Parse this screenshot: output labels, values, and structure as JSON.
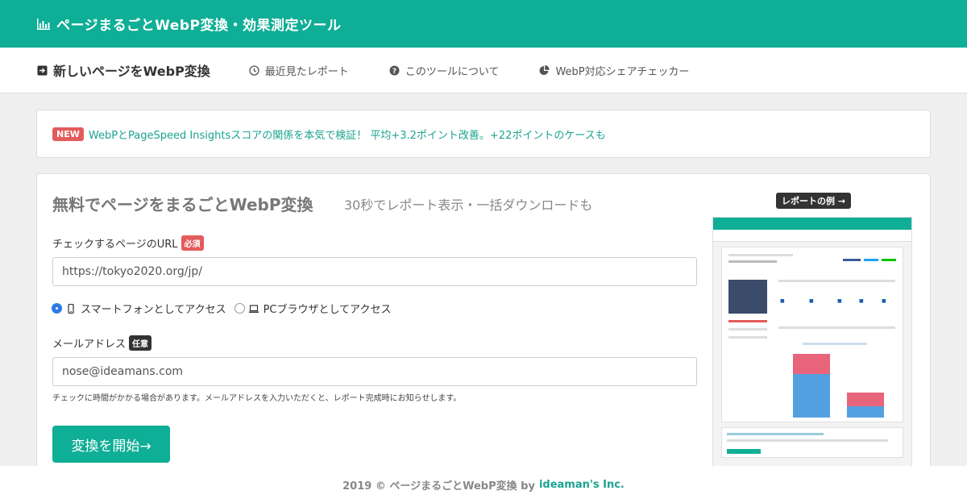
{
  "header": {
    "title": "ページまるごとWebP変換・効果測定ツール",
    "logo_icon": "bar-chart-icon"
  },
  "nav": {
    "items": [
      {
        "label": "新しいページをWebP変換",
        "icon": "sign-in-icon"
      },
      {
        "label": "最近見たレポート",
        "icon": "clock-icon"
      },
      {
        "label": "このツールについて",
        "icon": "question-circle-icon"
      },
      {
        "label": "WebP対応シェアチェッカー",
        "icon": "pie-chart-icon"
      }
    ]
  },
  "notice": {
    "badge": "NEW",
    "text": "WebPとPageSpeed Insightsスコアの関係を本気で検証！ 平均+3.2ポイント改善。+22ポイントのケースも"
  },
  "form": {
    "title": "無料でページをまるごとWebP変換",
    "subtitle": "30秒でレポート表示・一括ダウンロードも",
    "url_label": "チェックするページのURL",
    "url_required": "必須",
    "url_value": "https://tokyo2020.org/jp/",
    "device_options": [
      {
        "label": "スマートフォンとしてアクセス",
        "checked": true,
        "icon": "mobile-icon"
      },
      {
        "label": "PCブラウザとしてアクセス",
        "checked": false,
        "icon": "laptop-icon"
      }
    ],
    "email_label": "メールアドレス",
    "email_optional": "任意",
    "email_value": "nose@ideamans.com",
    "email_help": "チェックに時間がかかる場合があります。メールアドレスを入力いただくと、レポート完成時にお知らせします。",
    "submit_label": "変換を開始→"
  },
  "example": {
    "badge": "レポートの例 →"
  },
  "footer": {
    "text": "2019 © ページまるごとWebP変換 by",
    "link": "ideaman's Inc."
  },
  "colors": {
    "brand": "#0fae96",
    "danger": "#e45b5b",
    "link": "#1aa391"
  }
}
